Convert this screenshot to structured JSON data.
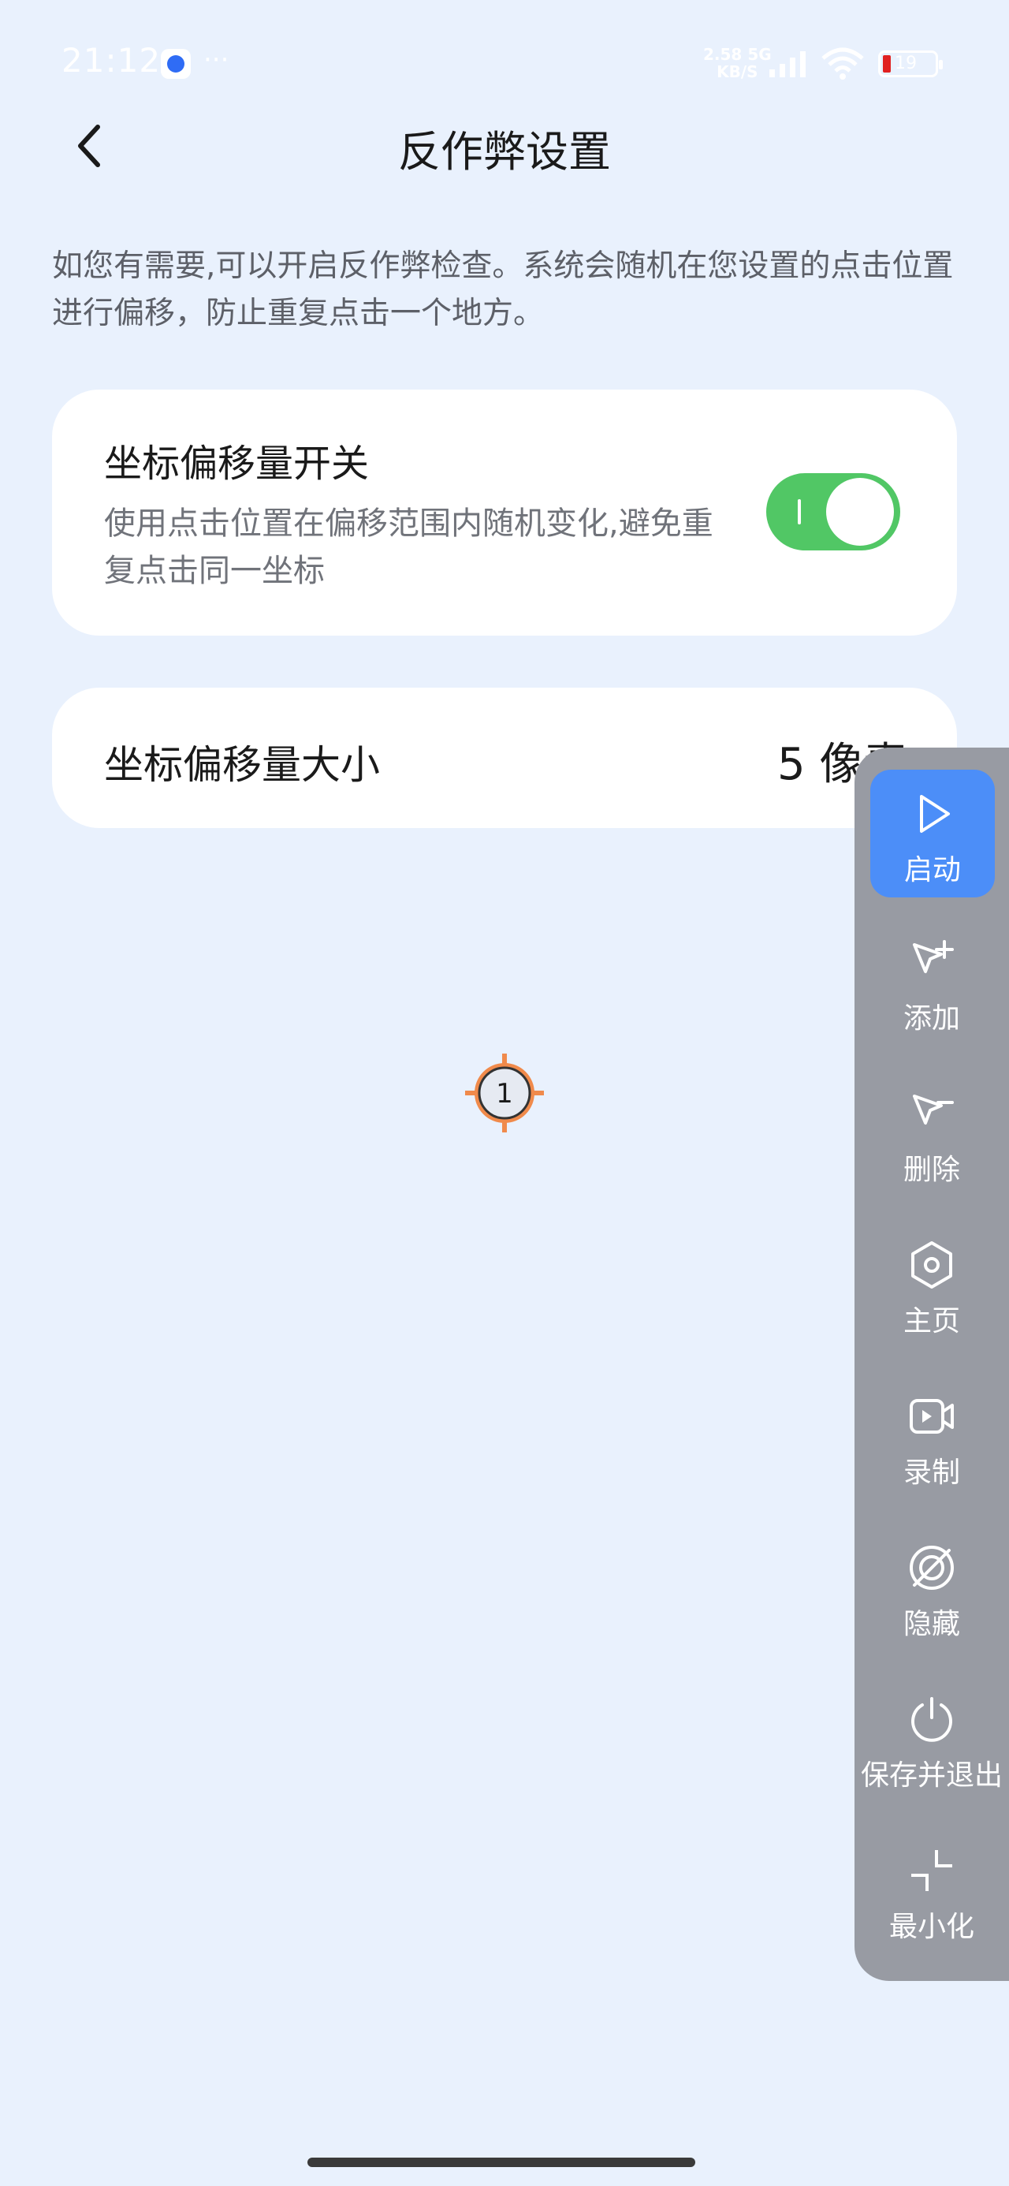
{
  "status_bar": {
    "time": "21:12",
    "speed_value": "2.58",
    "speed_unit": "KB/S",
    "network": "5G",
    "battery": "19"
  },
  "header": {
    "title": "反作弊设置"
  },
  "description": "如您有需要,可以开启反作弊检查。系统会随机在您设置的点击位置进行偏移，防止重复点击一个地方。",
  "switch_card": {
    "title": "坐标偏移量开关",
    "description": "使用点击位置在偏移范围内随机变化,避免重复点击同一坐标",
    "enabled": true
  },
  "offset_card": {
    "title": "坐标偏移量大小",
    "value": "5 像素"
  },
  "click_marker": {
    "number": "1"
  },
  "toolbar": {
    "items": [
      {
        "label": "启动",
        "icon": "play-icon"
      },
      {
        "label": "添加",
        "icon": "cursor-add-icon"
      },
      {
        "label": "删除",
        "icon": "cursor-remove-icon"
      },
      {
        "label": "主页",
        "icon": "hexagon-icon"
      },
      {
        "label": "录制",
        "icon": "video-record-icon"
      },
      {
        "label": "隐藏",
        "icon": "hide-icon"
      },
      {
        "label": "保存并退出",
        "icon": "power-icon"
      },
      {
        "label": "最小化",
        "icon": "minimize-icon"
      }
    ]
  },
  "colors": {
    "accent": "#4c8ef8",
    "toggle_on": "#51c765",
    "marker": "#f08a4b",
    "background": "#e9f1fd"
  }
}
